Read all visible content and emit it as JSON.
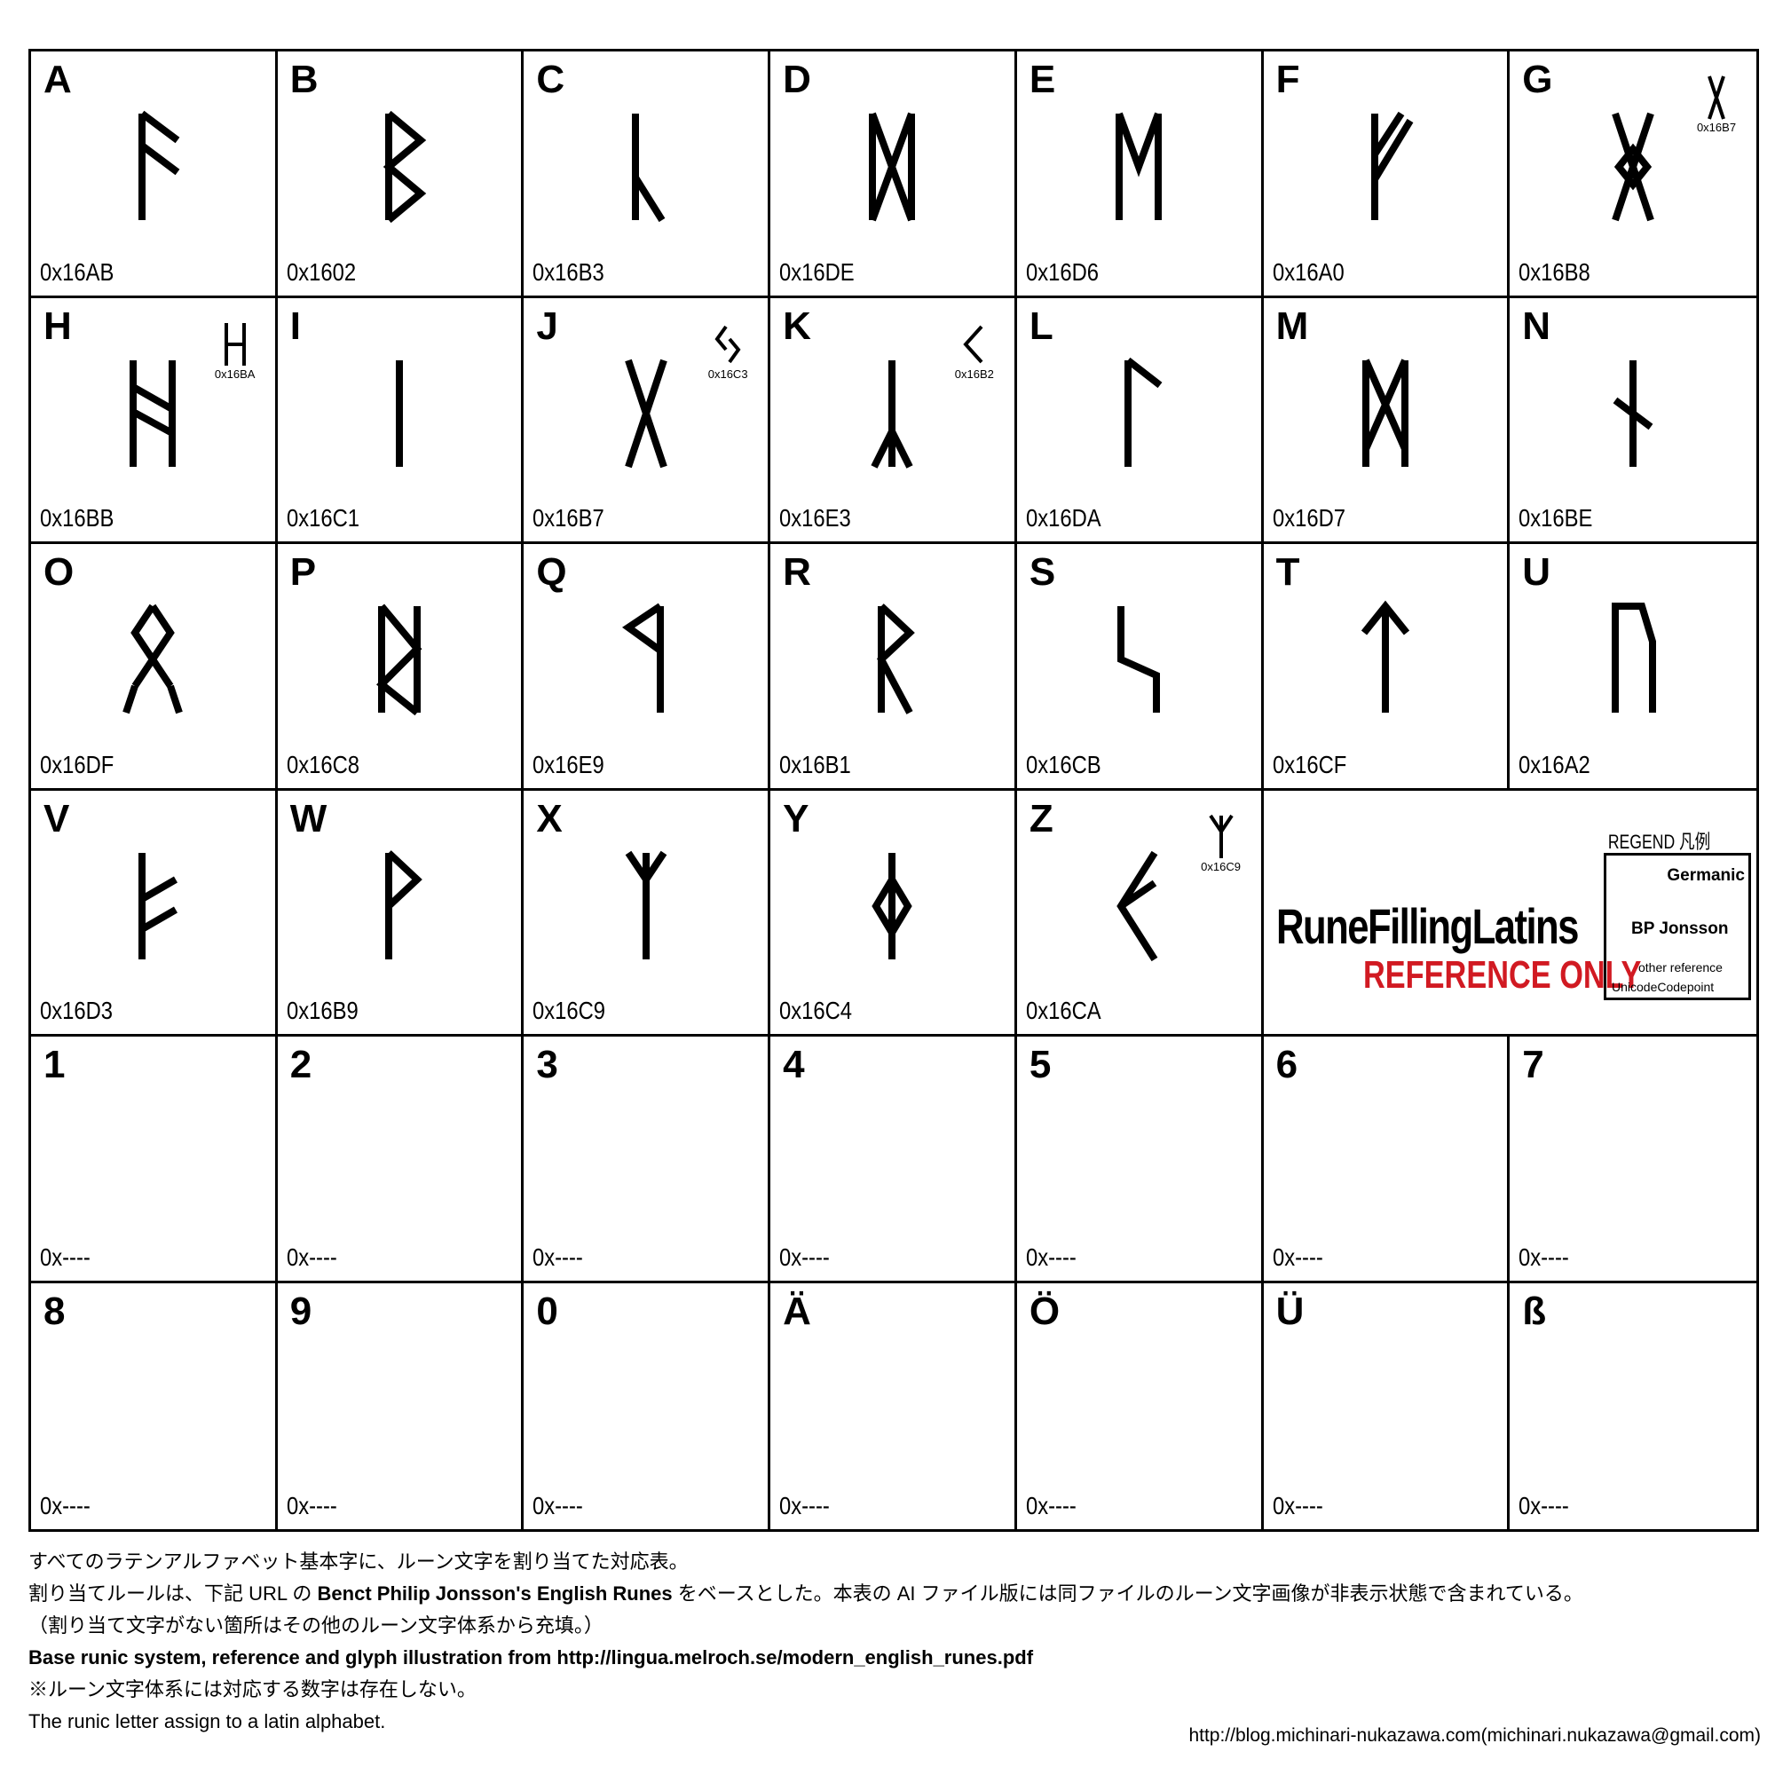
{
  "grid": {
    "cells": [
      {
        "letter": "A",
        "code": "0x16AB",
        "rune": "0x16AB"
      },
      {
        "letter": "B",
        "code": "0x1602",
        "rune": "0x1602"
      },
      {
        "letter": "C",
        "code": "0x16B3",
        "rune": "0x16B3"
      },
      {
        "letter": "D",
        "code": "0x16DE",
        "rune": "0x16DE"
      },
      {
        "letter": "E",
        "code": "0x16D6",
        "rune": "0x16D6"
      },
      {
        "letter": "F",
        "code": "0x16A0",
        "rune": "0x16A0"
      },
      {
        "letter": "G",
        "code": "0x16B8",
        "rune": "0x16B8",
        "alt": {
          "code": "0x16B7"
        }
      },
      {
        "letter": "H",
        "code": "0x16BB",
        "rune": "0x16BB",
        "alt": {
          "code": "0x16BA"
        }
      },
      {
        "letter": "I",
        "code": "0x16C1",
        "rune": "0x16C1"
      },
      {
        "letter": "J",
        "code": "0x16B7",
        "rune": "0x16B7",
        "alt": {
          "code": "0x16C3"
        }
      },
      {
        "letter": "K",
        "code": "0x16E3",
        "rune": "0x16E3",
        "alt": {
          "code": "0x16B2"
        }
      },
      {
        "letter": "L",
        "code": "0x16DA",
        "rune": "0x16DA"
      },
      {
        "letter": "M",
        "code": "0x16D7",
        "rune": "0x16D7"
      },
      {
        "letter": "N",
        "code": "0x16BE",
        "rune": "0x16BE"
      },
      {
        "letter": "O",
        "code": "0x16DF",
        "rune": "0x16DF"
      },
      {
        "letter": "P",
        "code": "0x16C8",
        "rune": "0x16C8"
      },
      {
        "letter": "Q",
        "code": "0x16E9",
        "rune": "0x16E9"
      },
      {
        "letter": "R",
        "code": "0x16B1",
        "rune": "0x16B1"
      },
      {
        "letter": "S",
        "code": "0x16CB",
        "rune": "0x16CB"
      },
      {
        "letter": "T",
        "code": "0x16CF",
        "rune": "0x16CF"
      },
      {
        "letter": "U",
        "code": "0x16A2",
        "rune": "0x16A2"
      },
      {
        "letter": "V",
        "code": "0x16D3",
        "rune": "0x16D3"
      },
      {
        "letter": "W",
        "code": "0x16B9",
        "rune": "0x16B9"
      },
      {
        "letter": "X",
        "code": "0x16C9",
        "rune": "0x16C9"
      },
      {
        "letter": "Y",
        "code": "0x16C4",
        "rune": "0x16C4"
      },
      {
        "letter": "Z",
        "code": "0x16CA",
        "rune": "0x16CA",
        "alt": {
          "code": "0x16C9"
        }
      },
      {
        "letter": "1",
        "code": "0x----"
      },
      {
        "letter": "2",
        "code": "0x----"
      },
      {
        "letter": "3",
        "code": "0x----"
      },
      {
        "letter": "4",
        "code": "0x----"
      },
      {
        "letter": "5",
        "code": "0x----"
      },
      {
        "letter": "6",
        "code": "0x----"
      },
      {
        "letter": "7",
        "code": "0x----"
      },
      {
        "letter": "8",
        "code": "0x----"
      },
      {
        "letter": "9",
        "code": "0x----"
      },
      {
        "letter": "0",
        "code": "0x----"
      },
      {
        "letter": "Ä",
        "code": "0x----"
      },
      {
        "letter": "Ö",
        "code": "0x----"
      },
      {
        "letter": "Ü",
        "code": "0x----"
      },
      {
        "letter": "ß",
        "code": "0x----"
      }
    ]
  },
  "title_block": {
    "brand": "RuneFillingLatins",
    "subtitle": "REFERENCE ONLY",
    "subtitle_color": "#d11a22",
    "legend_title": "REGEND 凡例",
    "legend": {
      "germanic": "Germanic",
      "bp": "BP Jonsson",
      "other": "other reference",
      "codepoint": "UnicodeCodepoint"
    }
  },
  "footer": {
    "line1": "すべてのラテンアルファベット基本字に、ルーン文字を割り当てた対応表。",
    "line2_pre": "割り当てルールは、下記 URL の ",
    "line2_bold": "Benct Philip Jonsson's English Runes",
    "line2_post": " をベースとした。本表の AI ファイル版には同ファイルのルーン文字画像が非表示状態で含まれている。",
    "line3": "（割り当て文字がない箇所はその他のルーン文字体系から充填。）",
    "line4": "Base runic system, reference and glyph illustration from http://lingua.melroch.se/modern_english_runes.pdf",
    "line5": "※ルーン文字体系には対応する数字は存在しない。",
    "line6": "The runic letter assign to a latin alphabet.",
    "credit": "http://blog.michinari-nukazawa.com(michinari.nukazawa@gmail.com)"
  }
}
